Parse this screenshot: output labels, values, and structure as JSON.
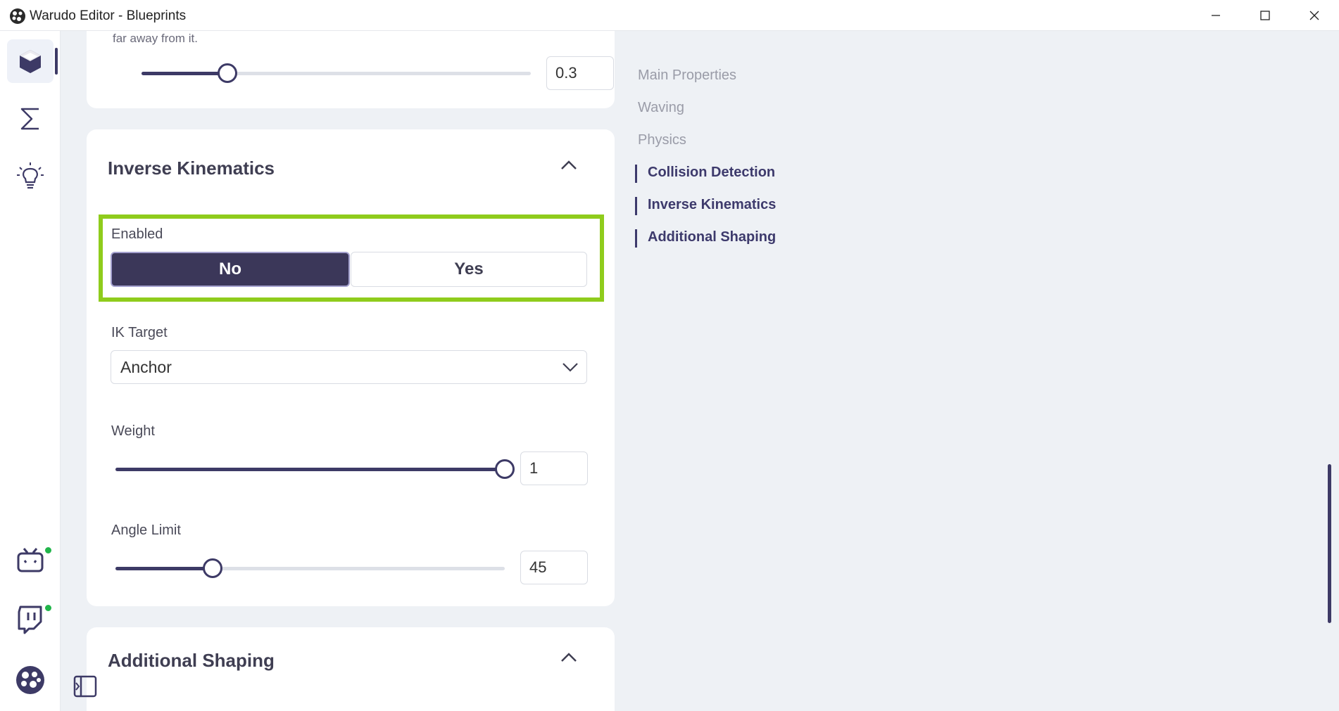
{
  "window": {
    "title": "Warudo Editor - Blueprints"
  },
  "rail": {
    "items": [
      {
        "icon": "cube-icon",
        "active": true
      },
      {
        "icon": "sigma-icon",
        "active": false
      },
      {
        "icon": "lightbulb-icon",
        "active": false
      },
      {
        "icon": "bilibili-icon",
        "status": "online"
      },
      {
        "icon": "twitch-icon",
        "status": "online"
      },
      {
        "icon": "warudo-logo-icon"
      }
    ]
  },
  "top_card": {
    "help_text": "far away from it.",
    "slider_value": "0.3",
    "slider_fraction": 0.22
  },
  "ik_section": {
    "title": "Inverse Kinematics",
    "enabled_label": "Enabled",
    "no_label": "No",
    "yes_label": "Yes",
    "enabled_value": "No",
    "ik_target_label": "IK Target",
    "ik_target_value": "Anchor",
    "weight_label": "Weight",
    "weight_value": "1",
    "weight_fraction": 1.0,
    "angle_limit_label": "Angle Limit",
    "angle_limit_value": "45",
    "angle_limit_fraction": 0.25
  },
  "shaping_section": {
    "title": "Additional Shaping"
  },
  "outline": {
    "items": [
      {
        "label": "Main Properties",
        "active": false
      },
      {
        "label": "Waving",
        "active": false
      },
      {
        "label": "Physics",
        "active": false
      },
      {
        "label": "Collision Detection",
        "active": true
      },
      {
        "label": "Inverse Kinematics",
        "active": true
      },
      {
        "label": "Additional Shaping",
        "active": true
      }
    ]
  },
  "colors": {
    "accent": "#3d3a66",
    "highlight": "#8fcc1c",
    "status_dot": "#21b54a"
  }
}
